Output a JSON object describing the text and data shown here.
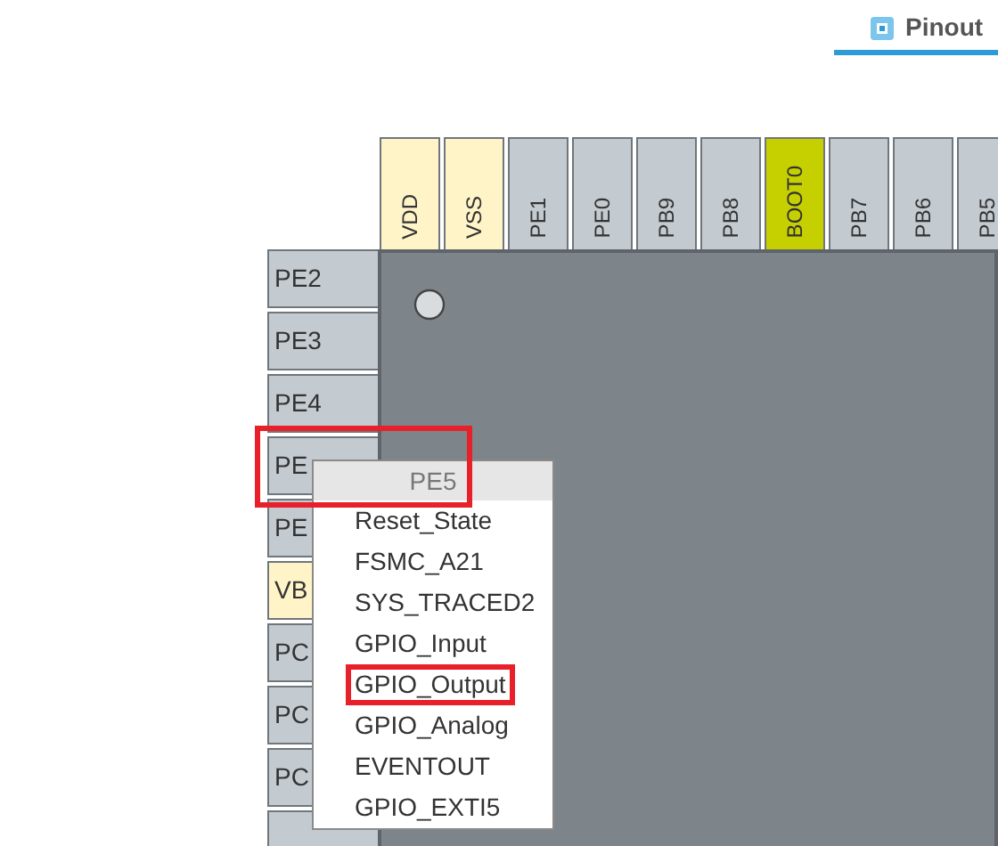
{
  "tab": {
    "label": "Pinout",
    "selected": true
  },
  "top_pins": [
    {
      "label": "VDD",
      "kind": "power"
    },
    {
      "label": "VSS",
      "kind": "power"
    },
    {
      "label": "PE1",
      "kind": "io"
    },
    {
      "label": "PE0",
      "kind": "io"
    },
    {
      "label": "PB9",
      "kind": "io"
    },
    {
      "label": "PB8",
      "kind": "io"
    },
    {
      "label": "BOOT0",
      "kind": "boot"
    },
    {
      "label": "PB7",
      "kind": "io"
    },
    {
      "label": "PB6",
      "kind": "io"
    },
    {
      "label": "PB5",
      "kind": "io"
    }
  ],
  "left_pins": [
    {
      "label": "PE2",
      "kind": "io",
      "highlighted": false
    },
    {
      "label": "PE3",
      "kind": "io",
      "highlighted": false
    },
    {
      "label": "PE4",
      "kind": "io",
      "highlighted": false
    },
    {
      "label": "PE",
      "kind": "io",
      "highlighted": true
    },
    {
      "label": "PE",
      "kind": "io",
      "highlighted": false
    },
    {
      "label": "VB",
      "kind": "power",
      "highlighted": false
    },
    {
      "label": "PC",
      "kind": "io",
      "highlighted": false
    },
    {
      "label": "PC",
      "kind": "io",
      "highlighted": false
    },
    {
      "label": "PC",
      "kind": "io",
      "highlighted": false
    },
    {
      "kind": "io",
      "highlighted": false
    }
  ],
  "pin_menu": {
    "title": "PE5",
    "items": [
      {
        "label": "Reset_State",
        "highlighted": false
      },
      {
        "label": "FSMC_A21",
        "highlighted": false
      },
      {
        "label": "SYS_TRACED2",
        "highlighted": false
      },
      {
        "label": "GPIO_Input",
        "highlighted": false
      },
      {
        "label": "GPIO_Output",
        "highlighted": true
      },
      {
        "label": "GPIO_Analog",
        "highlighted": false
      },
      {
        "label": "EVENTOUT",
        "highlighted": false
      },
      {
        "label": "GPIO_EXTI5",
        "highlighted": false
      }
    ]
  }
}
